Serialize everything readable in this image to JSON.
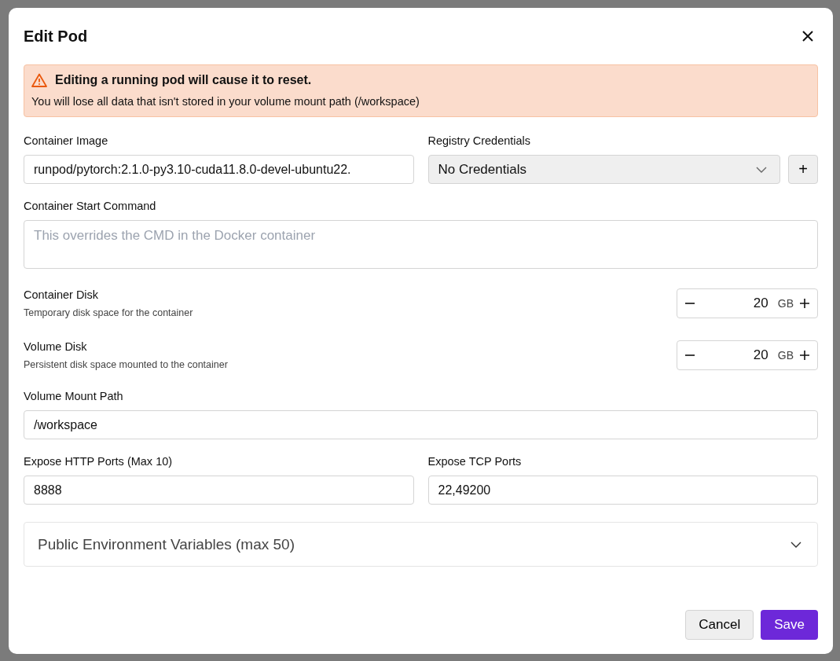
{
  "dialog": {
    "title": "Edit Pod"
  },
  "warning": {
    "title": "Editing a running pod will cause it to reset.",
    "message": "You will lose all data that isn't stored in your volume mount path (/workspace)"
  },
  "container_image": {
    "label": "Container Image",
    "value": "runpod/pytorch:2.1.0-py3.10-cuda11.8.0-devel-ubuntu22."
  },
  "registry_credentials": {
    "label": "Registry Credentials",
    "value": "No Credentials",
    "add_button": "+"
  },
  "start_command": {
    "label": "Container Start Command",
    "placeholder": "This overrides the CMD in the Docker container"
  },
  "disks": [
    {
      "label": "Container Disk",
      "hint": "Temporary disk space for the container",
      "value": "20",
      "unit": "GB"
    },
    {
      "label": "Volume Disk",
      "hint": "Persistent disk space mounted to the container",
      "value": "20",
      "unit": "GB"
    }
  ],
  "mount_path": {
    "label": "Volume Mount Path",
    "value": "/workspace"
  },
  "ports": [
    {
      "label": "Expose HTTP Ports (Max 10)",
      "value": "8888"
    },
    {
      "label": "Expose TCP Ports",
      "value": "22,49200"
    }
  ],
  "env_section": {
    "label": "Public Environment Variables (max 50)",
    "expanded": false
  },
  "buttons": {
    "cancel": "Cancel",
    "save": "Save"
  }
}
